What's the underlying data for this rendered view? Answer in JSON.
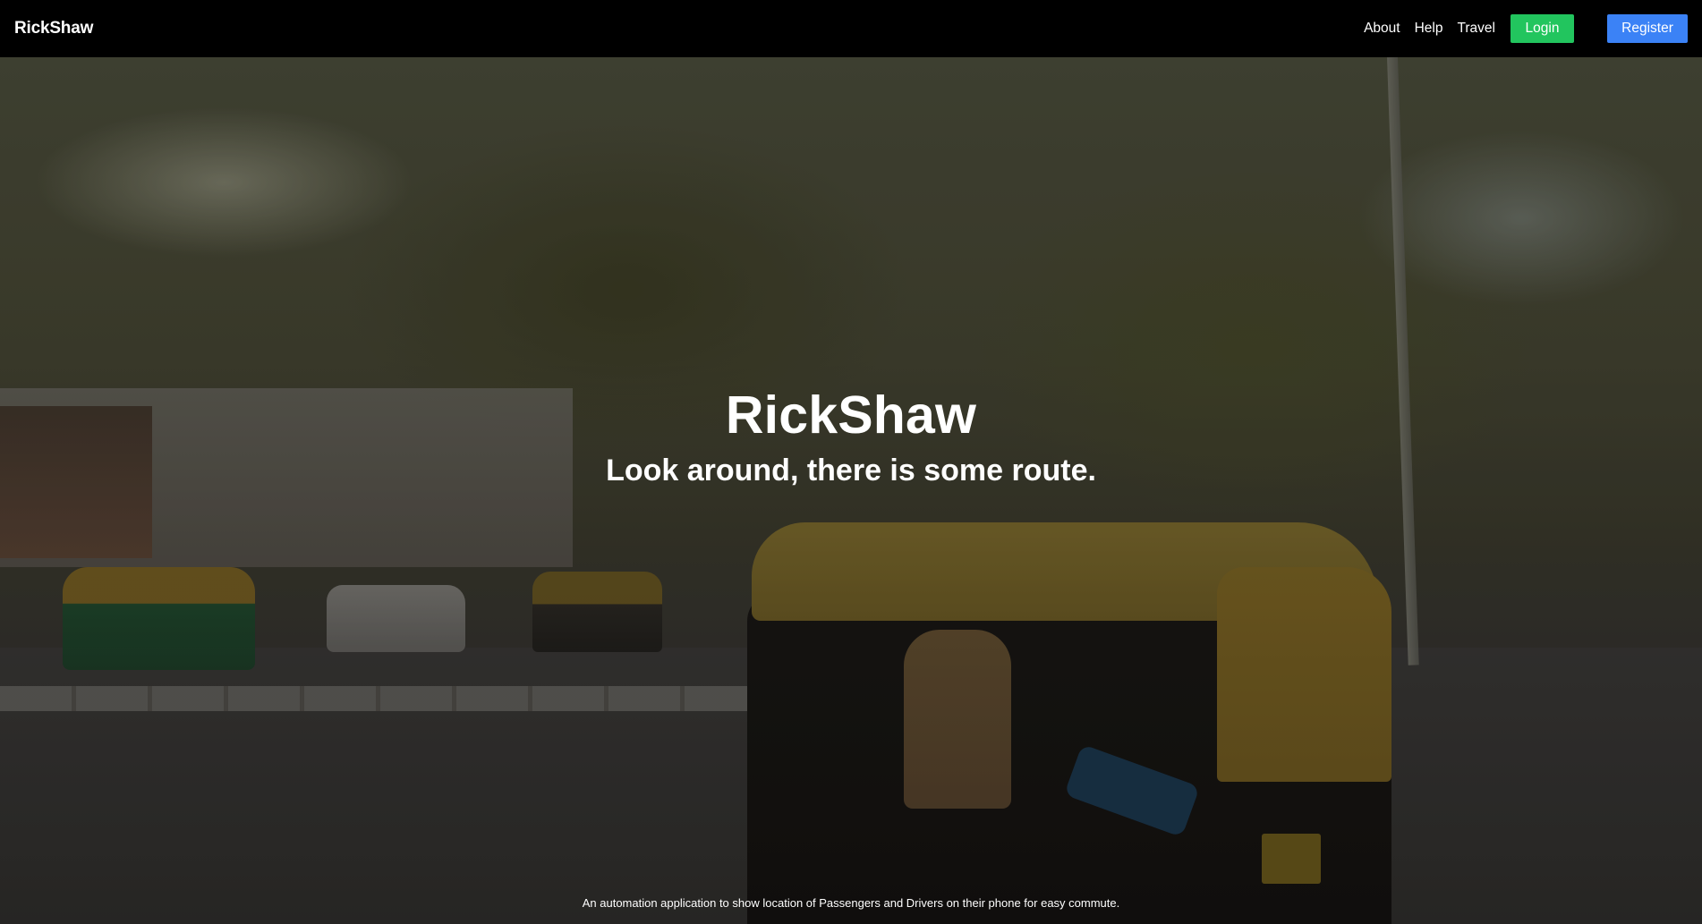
{
  "navbar": {
    "brand": "RickShaw",
    "links": [
      "About",
      "Help",
      "Travel"
    ],
    "login_label": "Login",
    "register_label": "Register"
  },
  "hero": {
    "title": "RickShaw",
    "subtitle": "Look around, there is some route.",
    "footer_text": "An automation application to show location of Passengers and Drivers on their phone for easy commute."
  },
  "colors": {
    "navbar_bg": "#000000",
    "login_button": "#22c55e",
    "register_button": "#3b82f6",
    "text": "#ffffff"
  }
}
